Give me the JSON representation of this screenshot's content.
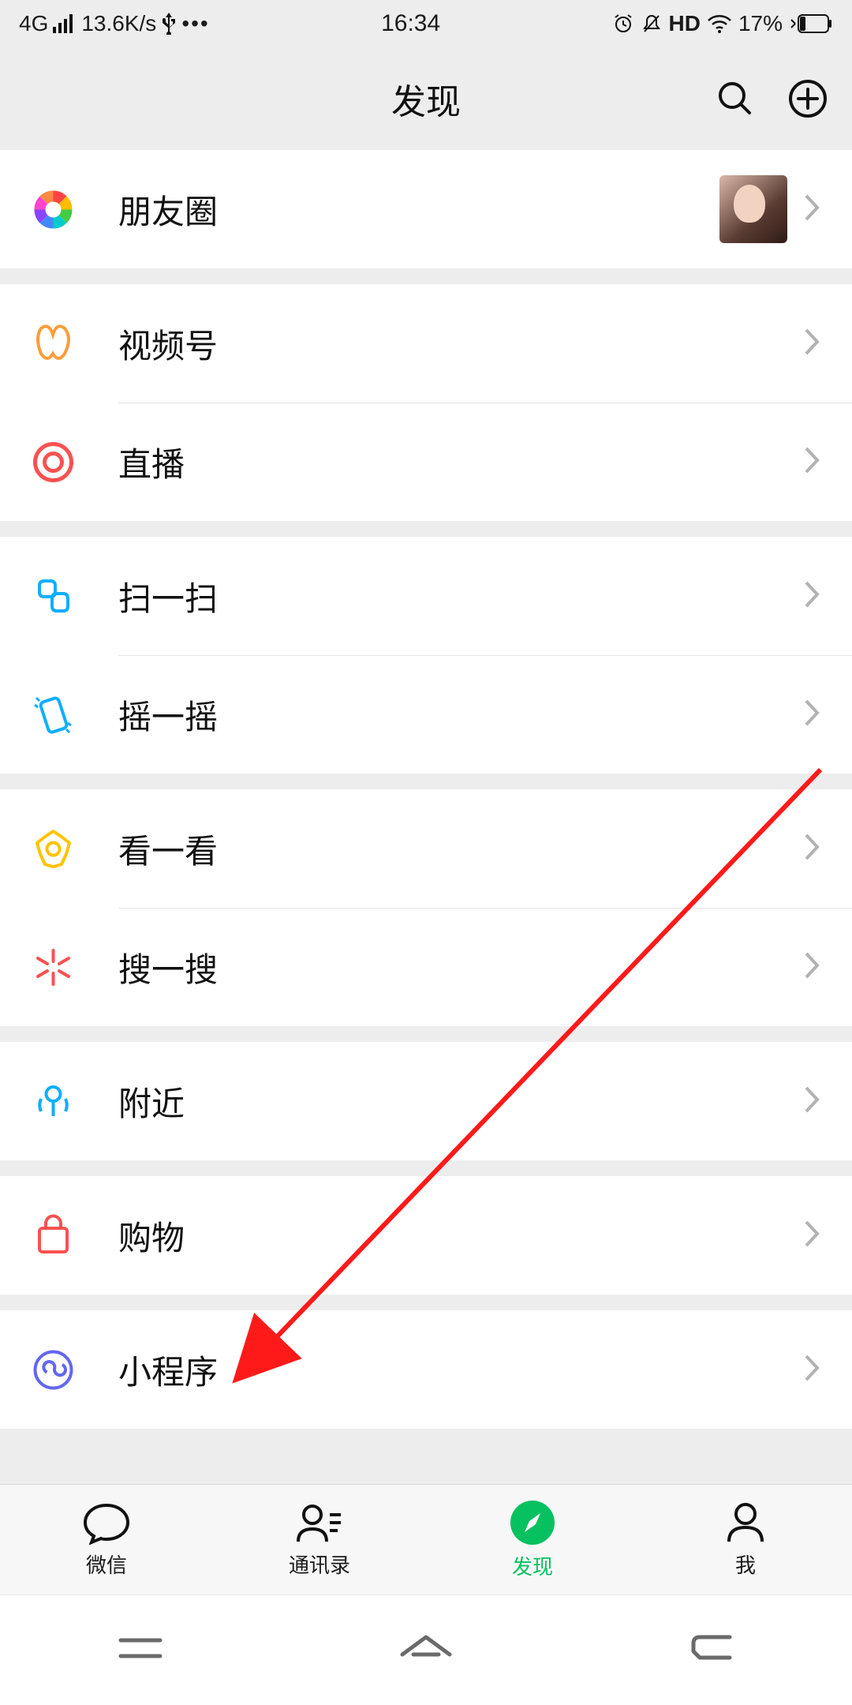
{
  "status": {
    "network": "4G",
    "speed": "13.6K/s",
    "time": "16:34",
    "hd": "HD",
    "battery": "17%"
  },
  "header": {
    "title": "发现"
  },
  "items": {
    "moments": "朋友圈",
    "channels": "视频号",
    "live": "直播",
    "scan": "扫一扫",
    "shake": "摇一摇",
    "topstories": "看一看",
    "search": "搜一搜",
    "nearby": "附近",
    "shopping": "购物",
    "miniprograms": "小程序"
  },
  "tabs": {
    "chat": "微信",
    "contacts": "通讯录",
    "discover": "发现",
    "me": "我"
  }
}
